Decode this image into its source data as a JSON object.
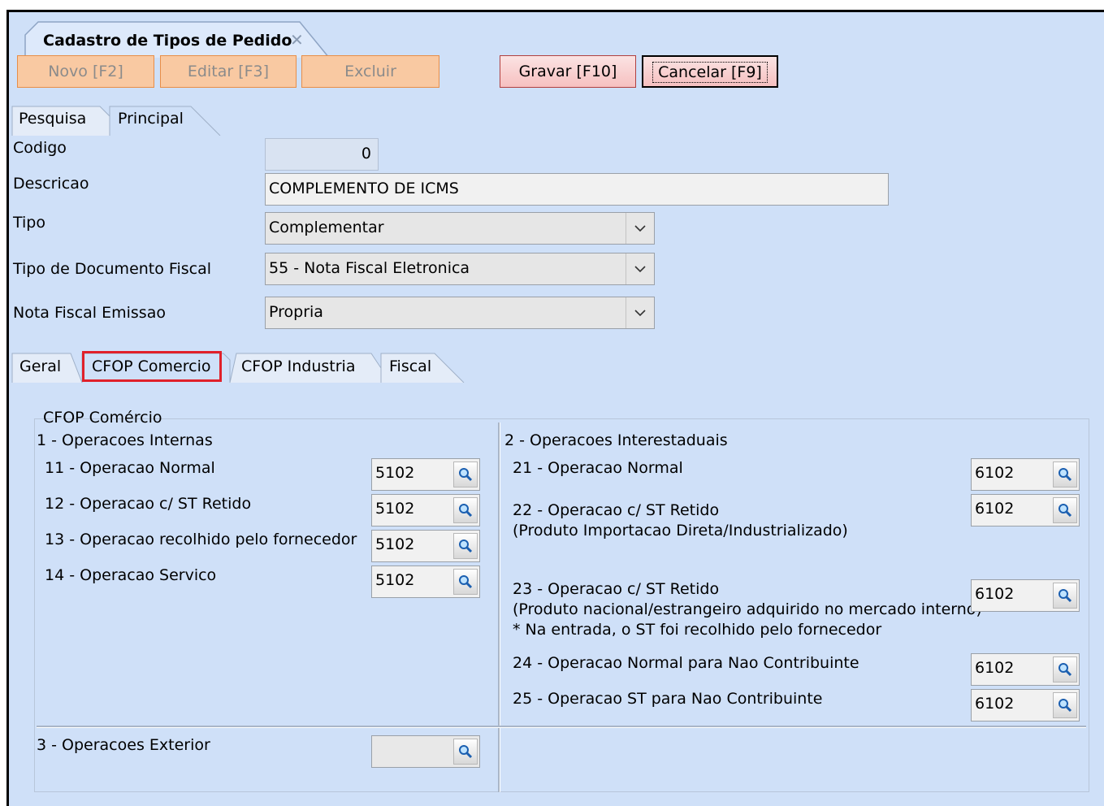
{
  "window": {
    "tab_title": "Cadastro de Tipos de Pedido",
    "close_glyph": "✕"
  },
  "toolbar": {
    "novo": "Novo [F2]",
    "editar": "Editar [F3]",
    "excluir": "Excluir",
    "gravar": "Gravar [F10]",
    "cancelar": "Cancelar [F9]"
  },
  "page_tabs": [
    "Pesquisa",
    "Principal"
  ],
  "form": {
    "codigo_label": "Codigo",
    "codigo_value": "0",
    "descricao_label": "Descricao",
    "descricao_value": "COMPLEMENTO DE ICMS",
    "tipo_label": "Tipo",
    "tipo_value": "Complementar",
    "tipo_doc_label": "Tipo de Documento Fiscal",
    "tipo_doc_value": "55 - Nota Fiscal Eletronica",
    "nf_emissao_label": "Nota Fiscal Emissao",
    "nf_emissao_value": "Propria"
  },
  "sub_tabs": [
    "Geral",
    "CFOP Comercio",
    "CFOP Industria",
    "Fiscal"
  ],
  "cfop": {
    "group_title": "CFOP Comércio",
    "internas": {
      "title": "1 - Operacoes Internas",
      "items": [
        {
          "label": "11 - Operacao Normal",
          "value": "5102"
        },
        {
          "label": "12 - Operacao c/ ST Retido",
          "value": "5102"
        },
        {
          "label": "13 - Operacao recolhido pelo fornecedor",
          "value": "5102"
        },
        {
          "label": "14 - Operacao Servico",
          "value": "5102"
        }
      ]
    },
    "interestaduais": {
      "title": "2 - Operacoes Interestaduais",
      "i21": {
        "label": "21 - Operacao Normal",
        "value": "6102"
      },
      "i22": {
        "label": "22 - Operacao c/ ST Retido",
        "note": "(Produto Importacao Direta/Industrializado)",
        "value": "6102"
      },
      "i23": {
        "label": "23 - Operacao c/ ST Retido",
        "note1": "(Produto nacional/estrangeiro adquirido no mercado interno)",
        "note2": "* Na entrada, o ST foi recolhido pelo fornecedor",
        "value": "6102"
      },
      "i24": {
        "label": "24 - Operacao Normal para Nao Contribuinte",
        "value": "6102"
      },
      "i25": {
        "label": "25 - Operacao ST para Nao Contribuinte",
        "value": "6102"
      }
    },
    "exterior": {
      "title": "3 - Operacoes Exterior",
      "value": ""
    }
  },
  "colors": {
    "background": "#cfe0f8",
    "highlight": "#e0202a"
  }
}
